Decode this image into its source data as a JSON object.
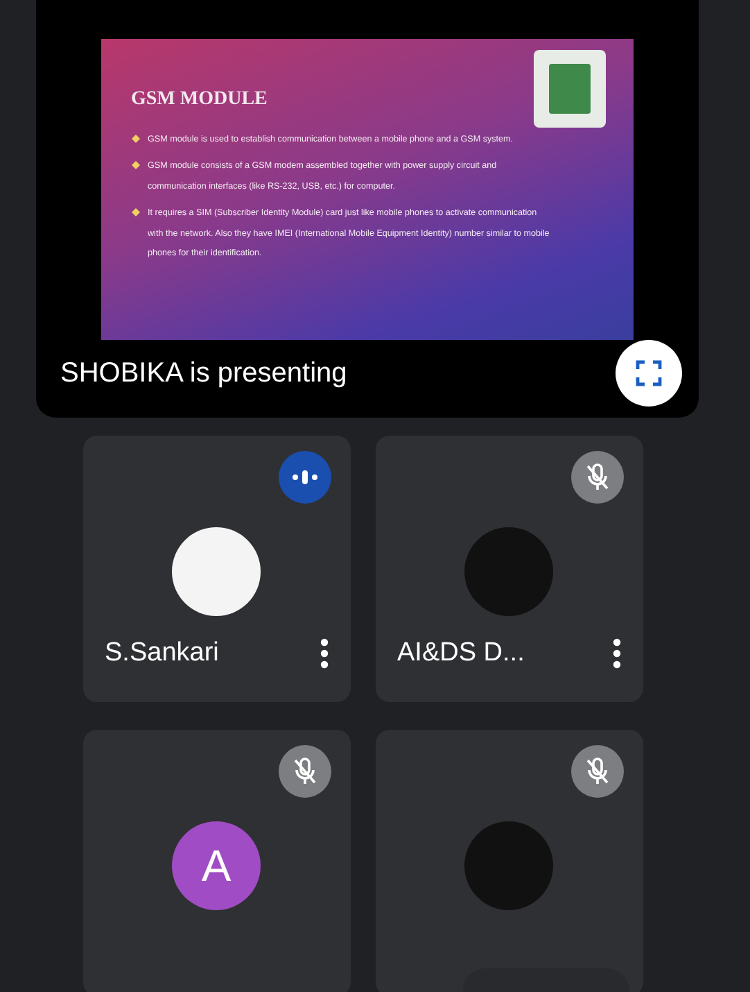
{
  "presentation": {
    "slide": {
      "title": "GSM MODULE",
      "bullets": [
        "GSM module is used to establish communication between a mobile phone and a GSM system.",
        "GSM module consists of a GSM modem assembled together with power supply circuit and communication interfaces (like RS-232, USB, etc.) for computer.",
        "It requires a SIM (Subscriber Identity Module) card just like mobile phones to activate communication with the network. Also they have IMEI (International Mobile Equipment Identity) number similar to mobile phones for their identification."
      ]
    },
    "caption": "SHOBIKA is presenting"
  },
  "participants": [
    {
      "name": "S.Sankari",
      "kind": "photo",
      "speaking": true
    },
    {
      "name": "AI&DS D...",
      "kind": "logo",
      "speaking": false
    },
    {
      "kind": "letter",
      "initial": "A",
      "color": "#a04cc4",
      "speaking": false
    },
    {
      "kind": "logo",
      "speaking": false
    }
  ]
}
